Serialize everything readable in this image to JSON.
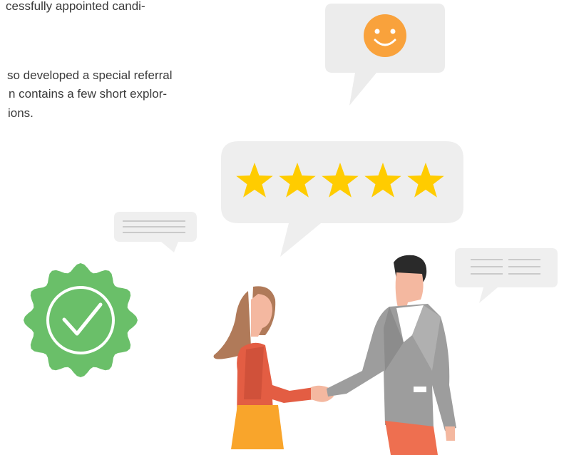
{
  "text": {
    "lines": [
      "cessfully appointed candi-",
      "so developed a special referral",
      "n contains a few short explor-",
      "ions."
    ]
  },
  "illustration": {
    "rating": {
      "stars": 5,
      "max": 5
    },
    "colors": {
      "bubble": "#efefef",
      "star": "#ffcc00",
      "smiley": "#f9a23c",
      "badge": "#6abf69",
      "woman_top": "#e35d43",
      "woman_skirt": "#f9a52b",
      "woman_hair": "#b07a59",
      "man_jacket": "#9d9d9d",
      "man_pants": "#ee6f50",
      "man_hair": "#2a2a2a",
      "skin": "#f4b8a0"
    },
    "icons": [
      "smiley-icon",
      "star-icon",
      "check-badge-icon"
    ]
  }
}
